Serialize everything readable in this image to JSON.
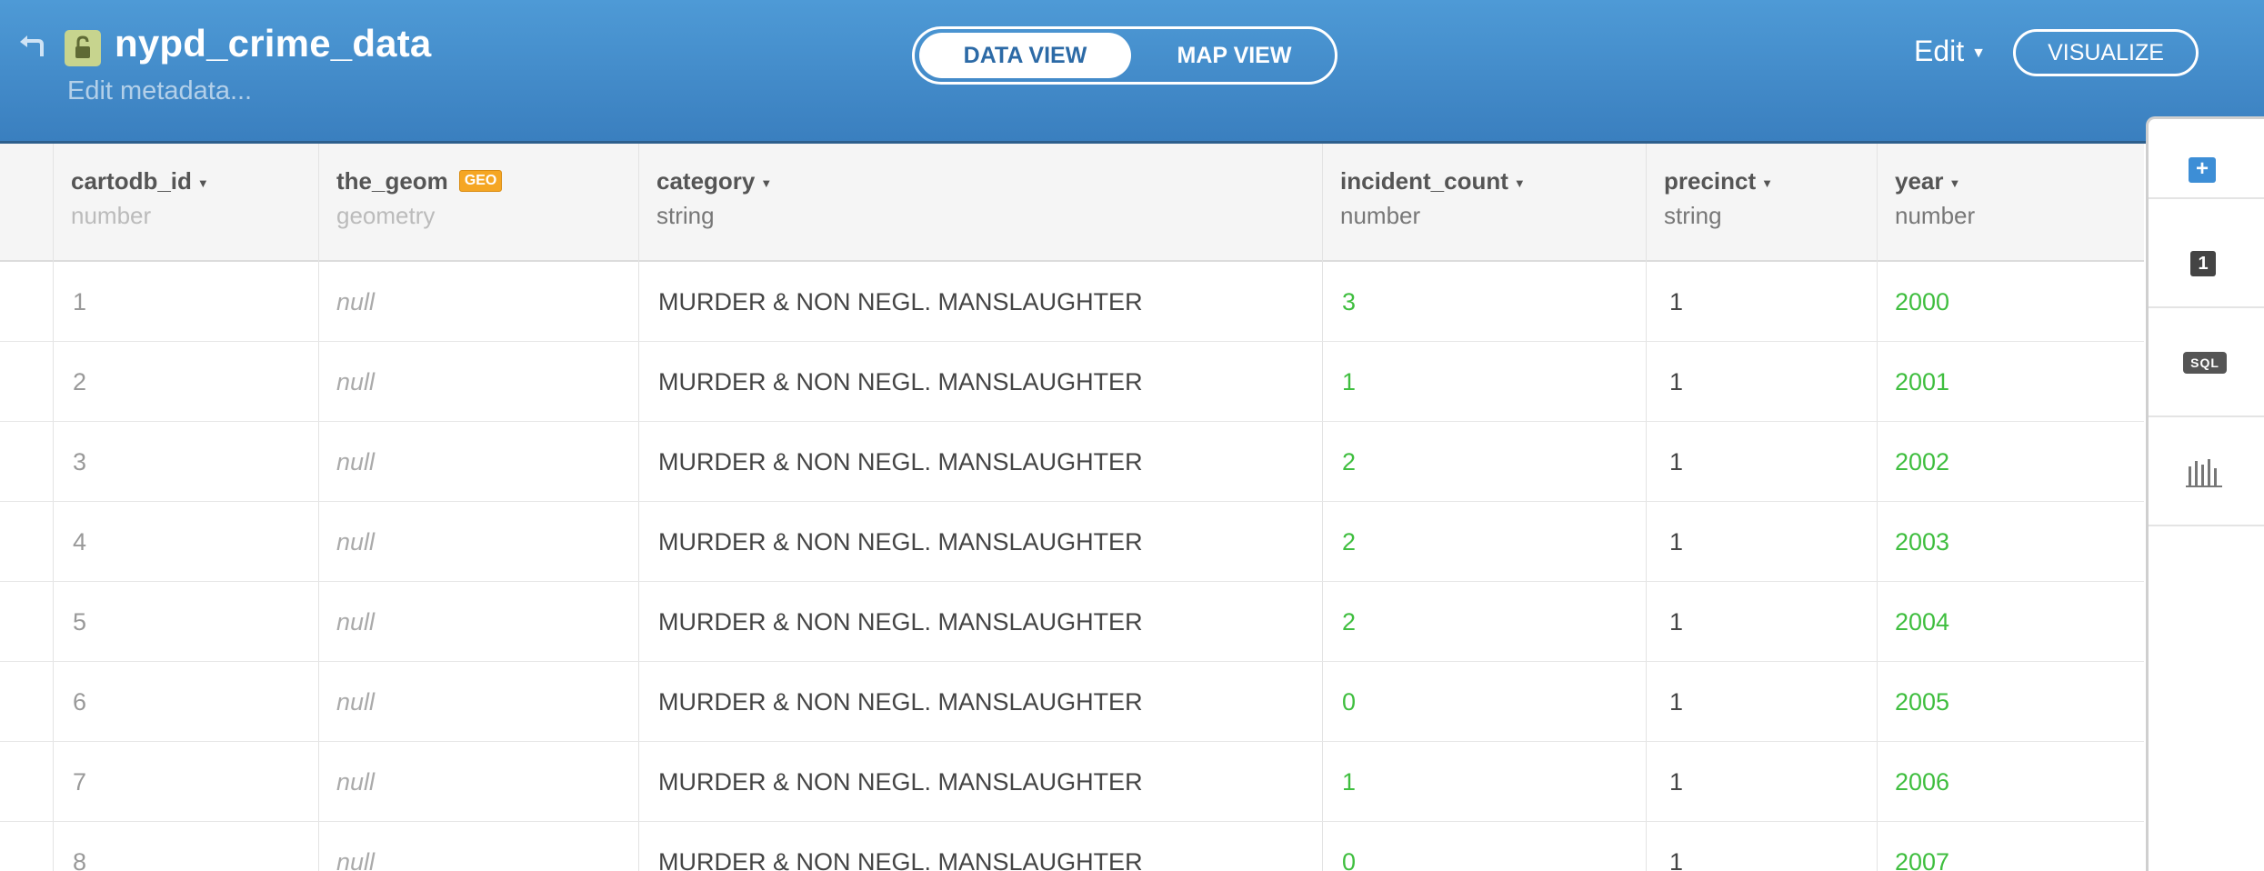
{
  "header": {
    "title": "nypd_crime_data",
    "subtitle": "Edit metadata...",
    "views": [
      "DATA VIEW",
      "MAP VIEW"
    ],
    "active_view": "DATA VIEW",
    "edit_label": "Edit",
    "visualize_label": "VISUALIZE",
    "back_icon": "back-arrow-icon",
    "lock_icon": "unlocked-padlock-icon"
  },
  "table": {
    "columns": [
      {
        "name": "cartodb_id",
        "type": "number"
      },
      {
        "name": "the_geom",
        "type": "geometry",
        "badge": "GEO"
      },
      {
        "name": "category",
        "type": "string"
      },
      {
        "name": "incident_count",
        "type": "number"
      },
      {
        "name": "precinct",
        "type": "string"
      },
      {
        "name": "year",
        "type": "number"
      }
    ],
    "rows": [
      [
        "1",
        "null",
        "MURDER & NON NEGL. MANSLAUGHTER",
        "3",
        "1",
        "2000"
      ],
      [
        "2",
        "null",
        "MURDER & NON NEGL. MANSLAUGHTER",
        "1",
        "1",
        "2001"
      ],
      [
        "3",
        "null",
        "MURDER & NON NEGL. MANSLAUGHTER",
        "2",
        "1",
        "2002"
      ],
      [
        "4",
        "null",
        "MURDER & NON NEGL. MANSLAUGHTER",
        "2",
        "1",
        "2003"
      ],
      [
        "5",
        "null",
        "MURDER & NON NEGL. MANSLAUGHTER",
        "2",
        "1",
        "2004"
      ],
      [
        "6",
        "null",
        "MURDER & NON NEGL. MANSLAUGHTER",
        "0",
        "1",
        "2005"
      ],
      [
        "7",
        "null",
        "MURDER & NON NEGL. MANSLAUGHTER",
        "1",
        "1",
        "2006"
      ],
      [
        "8",
        "null",
        "MURDER & NON NEGL. MANSLAUGHTER",
        "0",
        "1",
        "2007"
      ]
    ]
  },
  "side_panel": {
    "add_label": "+",
    "layer_count": "1",
    "sql_label": "SQL",
    "chart_icon": "bar-chart-icon"
  },
  "colors": {
    "header": "#4a93d2",
    "accent_green": "#3fbe3f",
    "geo_badge": "#f5a623"
  }
}
